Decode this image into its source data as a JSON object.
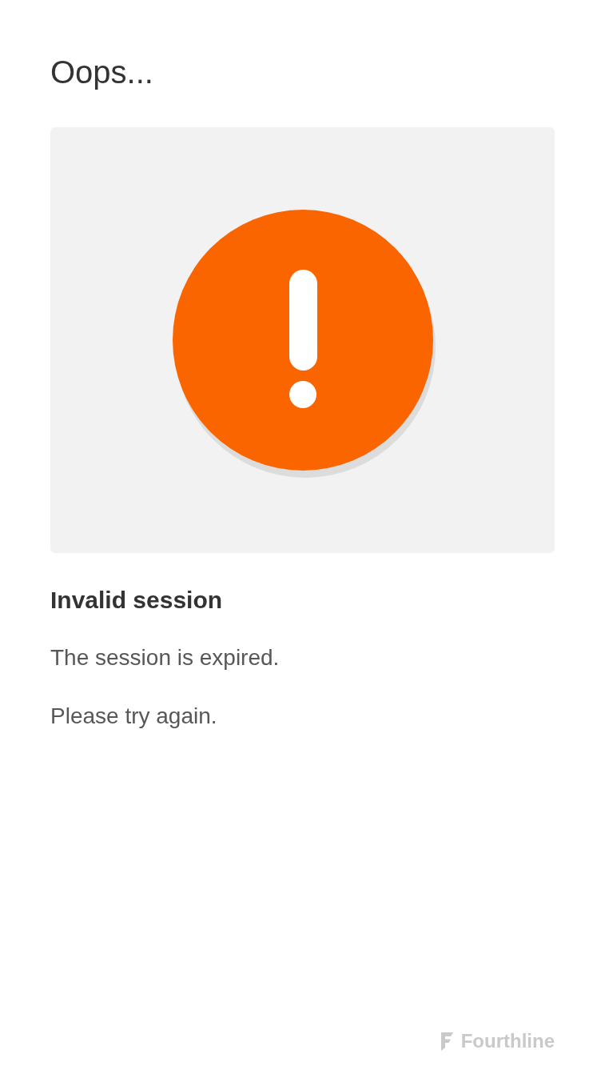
{
  "title": "Oops...",
  "message": {
    "heading": "Invalid session",
    "lines": [
      "The session is expired.",
      "Please try again."
    ]
  },
  "footer": {
    "brand": "Fourthline"
  }
}
